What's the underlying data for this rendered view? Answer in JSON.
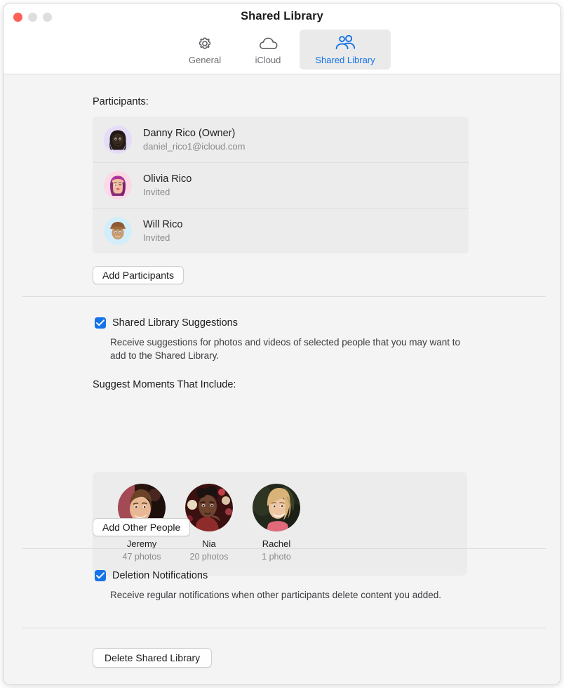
{
  "window": {
    "title": "Shared Library",
    "traffic_lights": [
      "close-button",
      "minimize-button",
      "maximize-button"
    ]
  },
  "toolbar": {
    "tabs": [
      {
        "label": "General",
        "icon": "gear-icon",
        "selected": false
      },
      {
        "label": "iCloud",
        "icon": "cloud-icon",
        "selected": false
      },
      {
        "label": "Shared Library",
        "icon": "people-icon",
        "selected": true
      }
    ],
    "selected_color": "#1473e6"
  },
  "participants_section": {
    "heading": "Participants:",
    "rows": [
      {
        "name": "Danny Rico (Owner)",
        "sub": "daniel_rico1@icloud.com",
        "avatar": "memoji-danny",
        "avatar_bg": "#e5dcf7"
      },
      {
        "name": "Olivia Rico",
        "sub": "Invited",
        "avatar": "memoji-olivia",
        "avatar_bg": "#fbd9e6"
      },
      {
        "name": "Will Rico",
        "sub": "Invited",
        "avatar": "memoji-will",
        "avatar_bg": "#d3eefb"
      }
    ],
    "add_button": "Add Participants"
  },
  "suggestions_section": {
    "checkbox_label": "Shared Library Suggestions",
    "checkbox_checked": true,
    "description": "Receive suggestions for photos and videos of selected people that you may want to add to the Shared Library.",
    "people_heading": "Suggest Moments That Include:",
    "people": [
      {
        "name": "Jeremy",
        "count": "47 photos",
        "photo": "photo-jeremy"
      },
      {
        "name": "Nia",
        "count": "20 photos",
        "photo": "photo-nia"
      },
      {
        "name": "Rachel",
        "count": "1 photo",
        "photo": "photo-rachel"
      }
    ],
    "add_button": "Add Other People"
  },
  "deletion_section": {
    "checkbox_label": "Deletion Notifications",
    "checkbox_checked": true,
    "description": "Receive regular notifications when other participants delete content you added."
  },
  "footer": {
    "delete_button": "Delete Shared Library"
  },
  "colors": {
    "accent": "#1473e6",
    "window_bg": "#f4f4f4",
    "group_bg": "#ececec",
    "close": "#ff5f57"
  }
}
